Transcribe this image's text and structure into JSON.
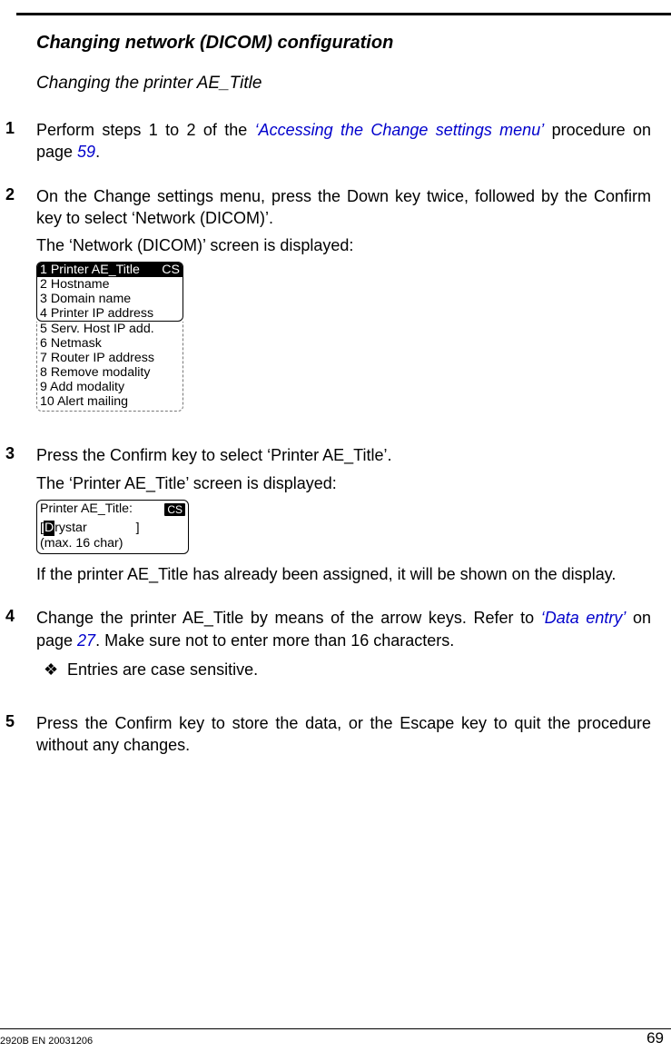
{
  "headings": {
    "h2": "Changing network (DICOM) configuration",
    "h3": "Changing the printer AE_Title"
  },
  "steps": {
    "s1": {
      "num": "1",
      "t1a": "Perform steps 1 to 2 of the ",
      "link1": "‘Accessing the Change settings menu’",
      "t1b": " procedure on page ",
      "pg1": "59",
      "t1c": "."
    },
    "s2": {
      "num": "2",
      "p1": "On the Change settings menu, press the Down key twice, followed by the Confirm key to select ‘Network (DICOM)’.",
      "p2": "The ‘Network (DICOM)’ screen is displayed:"
    },
    "s3": {
      "num": "3",
      "p1": "Press the Confirm key to select ‘Printer AE_Title’.",
      "p2": "The ‘Printer AE_Title’ screen is displayed:",
      "p3": "If the printer AE_Title has already been assigned, it will be shown on the display."
    },
    "s4": {
      "num": "4",
      "t1a": "Change the printer AE_Title by means of the arrow keys. Refer to ",
      "link1": "‘Data entry’",
      "t1b": " on page ",
      "pg1": "27",
      "t1c": ". Make sure not to enter more than 16 characters.",
      "bullet": "Entries are case sensitive."
    },
    "s5": {
      "num": "5",
      "p1": "Press the Confirm key to store the data, or the Escape key to quit the procedure without any changes."
    }
  },
  "lcd_menu": {
    "badge": "CS",
    "r1": "1 Printer AE_Title",
    "r2": "2 Hostname",
    "r3": "3 Domain name",
    "r4": "4 Printer IP address",
    "r5": "5 Serv. Host IP add.",
    "r6": "6 Netmask",
    "r7": "7 Router IP address",
    "r8": "8 Remove modality",
    "r9": "9 Add modality",
    "r10": "10 Alert mailing"
  },
  "lcd_entry": {
    "label": "Printer AE_Title:",
    "badge": "CS",
    "open": "[",
    "cursor": "D",
    "rest": "rystar",
    "close": "]",
    "hint": "(max. 16 char)"
  },
  "footer": {
    "left": "2920B EN 20031206",
    "right": "69"
  },
  "bullet_sym": "❖"
}
